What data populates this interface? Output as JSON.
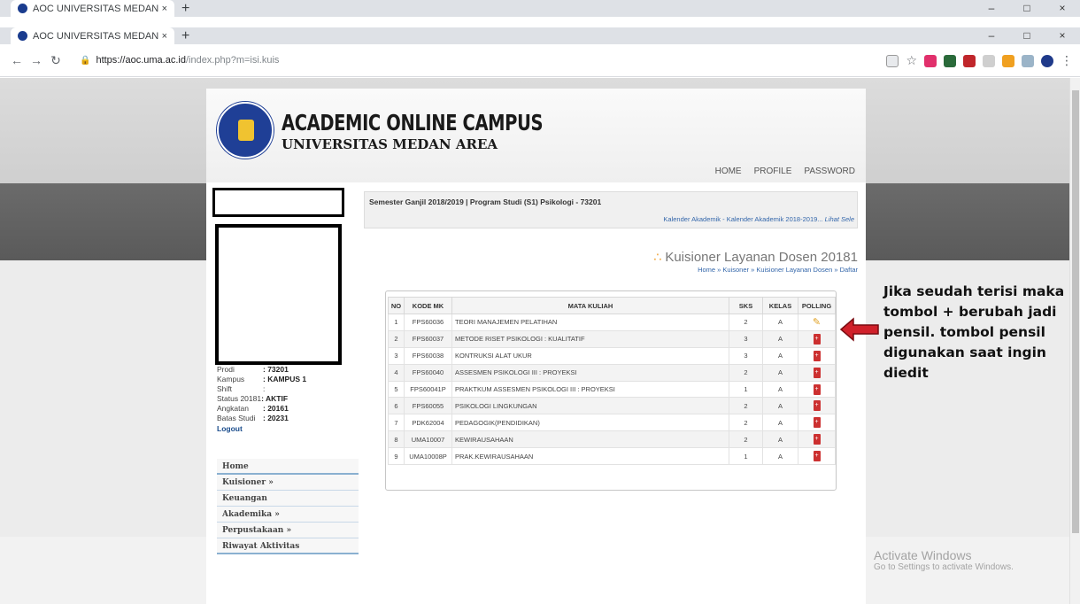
{
  "browser": {
    "tab_title": "AOC UNIVERSITAS MEDAN AREA",
    "tab_close": "×",
    "new_tab": "+",
    "win_min": "–",
    "win_max": "□",
    "win_close": "×",
    "url_host": "https://aoc.uma.ac.id",
    "url_path": "/index.php?m=isi.kuis",
    "icons": [
      "back-icon",
      "forward-icon",
      "reload-icon",
      "lock-icon",
      "translate-icon",
      "star-icon",
      "menu-icon"
    ]
  },
  "header": {
    "brand_line1": "ACADEMIC ONLINE CAMPUS",
    "brand_line2": "UNIVERSITAS MEDAN AREA",
    "nav": [
      "HOME",
      "PROFILE",
      "PASSWORD"
    ]
  },
  "profile": {
    "prodi_label": "Prodi",
    "prodi_value": ": 73201",
    "kampus_label": "Kampus",
    "kampus_value": ": KAMPUS 1",
    "shift_label": "Shift",
    "shift_value": ":",
    "status_label": "Status 20181",
    "status_value": ": AKTIF",
    "angkatan_label": "Angkatan",
    "angkatan_value": ": 20161",
    "batas_label": "Batas Studi",
    "batas_value": ": 20231",
    "logout": "Logout"
  },
  "menu": [
    "Home",
    "Kuisioner »",
    "Keuangan",
    "Akademika »",
    "Perpustakaan »",
    "Riwayat Aktivitas"
  ],
  "semester": {
    "text": "Semester Ganjil 2018/2019 | Program Studi (S1) Psikologi - 73201",
    "marquee": "Kalender Akademik - Kalender Akademik 2018-2019...",
    "marquee_link": "Lihat Sele"
  },
  "page": {
    "title": "Kuisioner Layanan Dosen 20181",
    "breadcrumb": "Home » Kuisoner » Kuisioner Layanan Dosen » Daftar"
  },
  "table": {
    "headers": [
      "NO",
      "KODE MK",
      "MATA KULIAH",
      "SKS",
      "KELAS",
      "POLLING"
    ],
    "rows": [
      {
        "no": "1",
        "kode": "FPS60036",
        "mk": "TEORI MANAJEMEN PELATIHAN",
        "sks": "2",
        "kelas": "A",
        "polling": "pencil"
      },
      {
        "no": "2",
        "kode": "FPS60037",
        "mk": "METODE RISET PSIKOLOGI : KUALITATIF",
        "sks": "3",
        "kelas": "A",
        "polling": "plus"
      },
      {
        "no": "3",
        "kode": "FPS60038",
        "mk": "KONTRUKSI ALAT UKUR",
        "sks": "3",
        "kelas": "A",
        "polling": "plus"
      },
      {
        "no": "4",
        "kode": "FPS60040",
        "mk": "ASSESMEN PSIKOLOGI III : PROYEKSI",
        "sks": "2",
        "kelas": "A",
        "polling": "plus"
      },
      {
        "no": "5",
        "kode": "FPS60041P",
        "mk": "PRAKTKUM ASSESMEN PSIKOLOGI III : PROYEKSI",
        "sks": "1",
        "kelas": "A",
        "polling": "plus"
      },
      {
        "no": "6",
        "kode": "FPS60055",
        "mk": "PSIKOLOGI LINGKUNGAN",
        "sks": "2",
        "kelas": "A",
        "polling": "plus"
      },
      {
        "no": "7",
        "kode": "PDK62004",
        "mk": "PEDAGOGIK(PENDIDIKAN)",
        "sks": "2",
        "kelas": "A",
        "polling": "plus"
      },
      {
        "no": "8",
        "kode": "UMA10007",
        "mk": "KEWIRAUSAHAAN",
        "sks": "2",
        "kelas": "A",
        "polling": "plus"
      },
      {
        "no": "9",
        "kode": "UMA10008P",
        "mk": "PRAK.KEWIRAUSAHAAN",
        "sks": "1",
        "kelas": "A",
        "polling": "plus"
      }
    ],
    "plus_glyph": "+",
    "pencil_glyph": "✎"
  },
  "annotation": {
    "text": "Jika seudah terisi maka tombol + berubah jadi pensil. tombol pensil digunakan saat ingin diedit",
    "arrow_color": "#d0202a"
  },
  "watermark": {
    "line1": "Activate Windows",
    "line2": "Go to Settings to activate Windows."
  },
  "colors": {
    "brand_blue": "#1f3f96",
    "link_blue": "#3366aa",
    "polling_red": "#cc3030",
    "pencil_gold": "#e0a020"
  }
}
